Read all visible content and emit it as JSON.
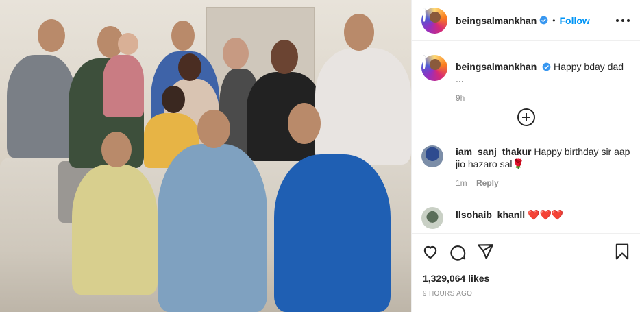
{
  "post": {
    "username": "beingsalmankhan",
    "follow_label": "Follow",
    "separator": "•",
    "caption_text": "Happy bday dad ...",
    "caption_time": "9h",
    "likes": "1,329,064 likes",
    "posted_ago": "9 HOURS AGO"
  },
  "comments": [
    {
      "username": "iam_sanj_thakur",
      "text": "Happy birthday sir aap jio hazaro sal🌹",
      "time": "1m",
      "reply_label": "Reply"
    },
    {
      "username": "llsohaib_khanll",
      "text": "❤️❤️❤️"
    }
  ],
  "icons": {
    "verified": "verified-badge-icon",
    "more": "more-options-icon",
    "load_more": "plus-circle-icon",
    "like": "heart-icon",
    "comment": "comment-icon",
    "share": "paper-plane-icon",
    "save": "bookmark-icon"
  },
  "colors": {
    "accent": "#0095f6",
    "text": "#262626",
    "muted": "#8e8e8e",
    "border": "#efefef"
  }
}
